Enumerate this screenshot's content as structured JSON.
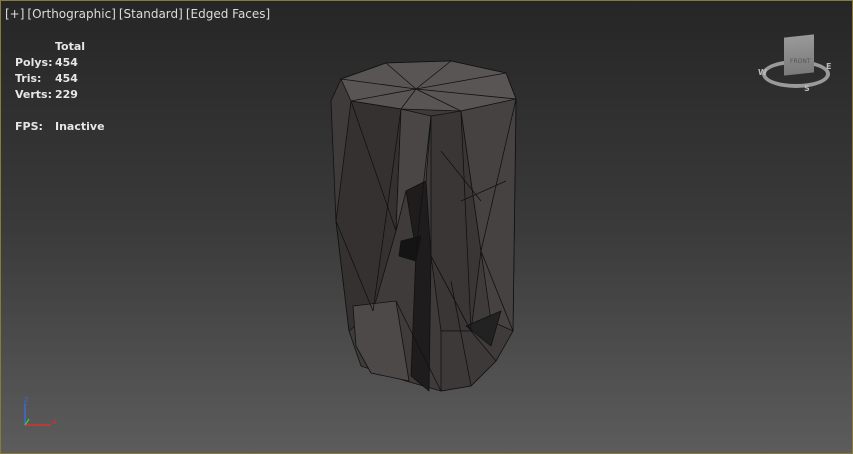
{
  "viewport_label": {
    "plus": "[+]",
    "view": "[Orthographic]",
    "shading_preset": "[Standard]",
    "display": "[Edged Faces]"
  },
  "stats": {
    "header": "Total",
    "rows": [
      {
        "label": "Polys:",
        "value": "454"
      },
      {
        "label": "Tris:",
        "value": "454"
      },
      {
        "label": "Verts:",
        "value": "229"
      }
    ],
    "fps_label": "FPS:",
    "fps_value": "Inactive"
  },
  "viewcube": {
    "face": "FRONT",
    "west": "W",
    "east": "E",
    "south": "S"
  },
  "axis": {
    "x": "x",
    "z": "z"
  }
}
